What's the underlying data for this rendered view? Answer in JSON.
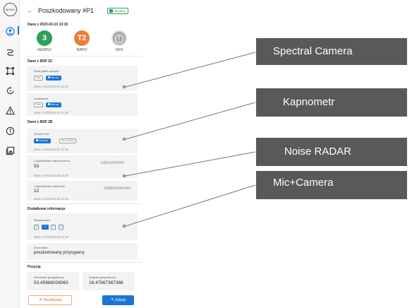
{
  "rail": {
    "logo": "MOMO"
  },
  "header": {
    "back": "←",
    "title": "Poszkodowany #P1",
    "badge": "Aktywny"
  },
  "triage": {
    "heading": "Dane z 2023-03-10 13:15",
    "scores": [
      {
        "value": "3",
        "label": "NEWS2",
        "color": "#2e9e5b"
      },
      {
        "value": "T2",
        "label": "NATO",
        "color": "#f07c3a"
      },
      {
        "value": "!",
        "label": "SRS",
        "color": "#a8a8a8"
      }
    ]
  },
  "bsp2c": {
    "heading": "Dane z BSP 2C",
    "items": [
      {
        "label": "Ruch gałek ocznych",
        "chips": [
          "brak",
          "Nie ma"
        ],
        "date": "Dane z 2023-03-10 13:15"
      },
      {
        "label": "Krwawienie",
        "chips": [
          "brak",
          "Nie ma"
        ],
        "date": "Dane z 2023-03-10 13:15"
      }
    ]
  },
  "bsp2b": {
    "heading": "Dane z BSP 2B",
    "co2": {
      "label": "Wzrost CO2",
      "chips": [
        "Wzrosło",
        "Nie wzrosło"
      ],
      "date": "Dane z 2023-03-10 13:15"
    },
    "heart": {
      "label": "Częstotliwość uderzeń serca",
      "value": "50",
      "unit": "uderzeń/min",
      "date": "Dane z 2023-03-10 13:15"
    },
    "breath": {
      "label": "Częstotliwość oddechów",
      "value": "12",
      "unit": "oddechów/min",
      "date": "Dane z 2023-03-10 13:15"
    }
  },
  "extra": {
    "heading": "Dodatkowe informacje",
    "avpu": {
      "label": "Świadomość",
      "options": [
        "A",
        "V",
        "P",
        "U"
      ],
      "selected": "V",
      "date": "Dane z 2023-03-10 13:15"
    },
    "comment": {
      "label": "Komentarz",
      "value": "poszkodowany przysypany"
    }
  },
  "position": {
    "heading": "Pozycja",
    "lat": {
      "label": "Szerokość geograficzna",
      "value": "53.45886026063"
    },
    "lon": {
      "label": "Długość geograficzna",
      "value": "16.47667367366"
    }
  },
  "actions": {
    "deactivate": "Dezaktywuj",
    "edit": "Edytuj"
  },
  "callouts": [
    {
      "text": "Spectral Camera"
    },
    {
      "text": "Kapnometr"
    },
    {
      "text": "Noise RADAR"
    },
    {
      "text": "Mic+Camera"
    }
  ],
  "colors": {
    "primary": "#1976d2",
    "callout_bg": "#595959",
    "success": "#2e9e5b",
    "warning": "#f07c3a"
  }
}
